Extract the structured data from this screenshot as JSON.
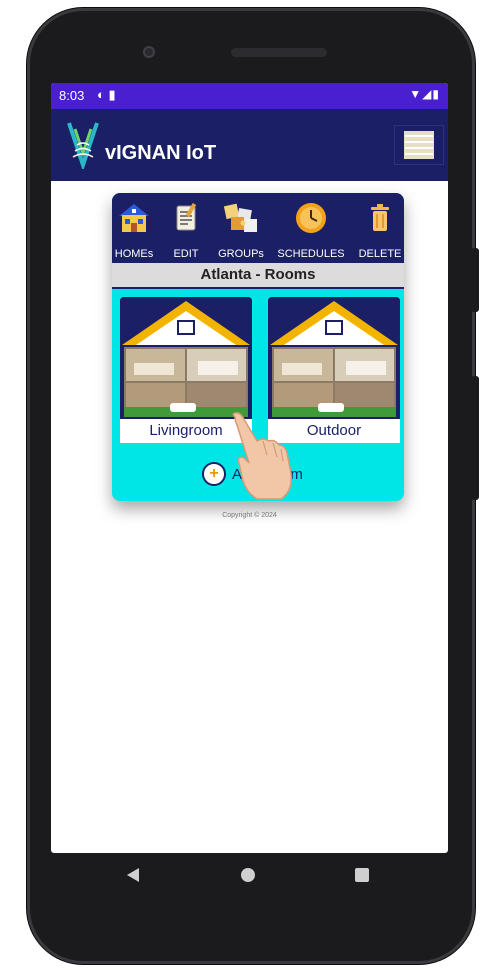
{
  "status": {
    "time": "8:03",
    "left_icons": "◐ ▮",
    "right_icons": "▼◢▮"
  },
  "appbar": {
    "title": "vIGNAN IoT",
    "logo_icon": "antenna-logo",
    "menu_icon": "hamburger-menu-icon"
  },
  "toolbar": {
    "items": [
      {
        "label": "HOMEs",
        "icon": "house-icon"
      },
      {
        "label": "EDIT",
        "icon": "edit-icon"
      },
      {
        "label": "GROUPs",
        "icon": "puzzle-icon"
      },
      {
        "label": "SCHEDULES",
        "icon": "clock-icon"
      },
      {
        "label": "DELETE",
        "icon": "trash-icon"
      }
    ]
  },
  "rooms_panel": {
    "title": "Atlanta - Rooms",
    "rooms": [
      {
        "name": "Livingroom"
      },
      {
        "name": "Outdoor"
      }
    ],
    "add_label": "Add Room"
  },
  "footer": {
    "copyright": "Copyright © 2024"
  },
  "colors": {
    "statusbar": "#4a1fd0",
    "appbar": "#1a1f66",
    "panel_bg": "#00e6e6",
    "accent": "#f2b400"
  }
}
